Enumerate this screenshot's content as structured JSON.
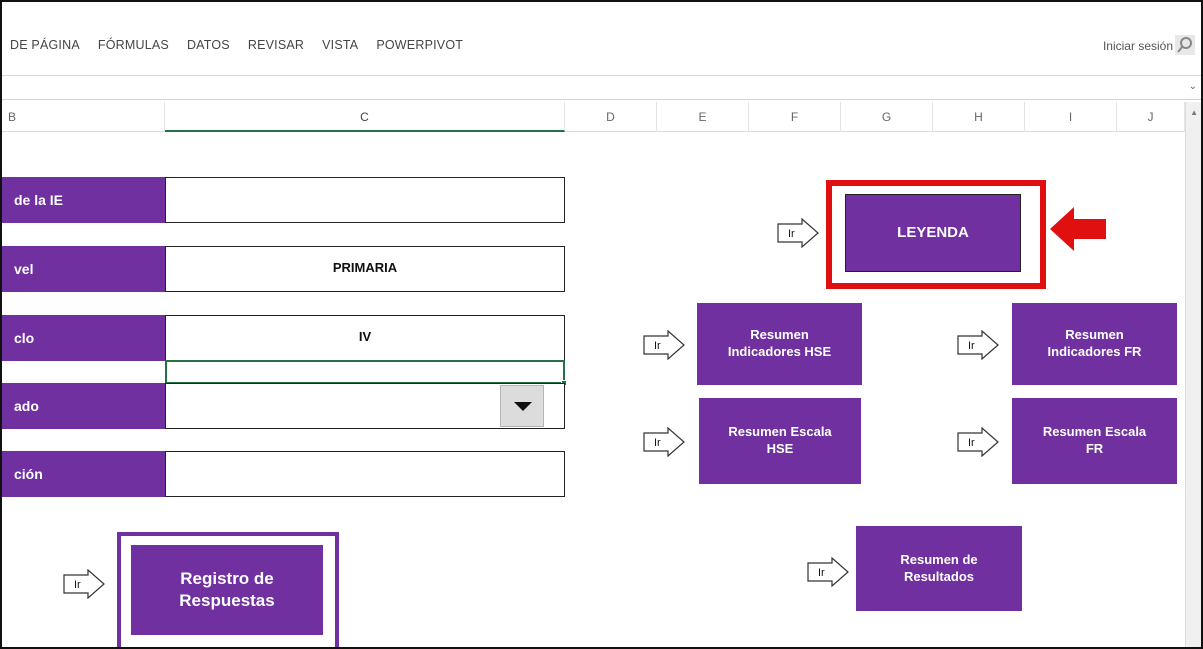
{
  "ribbon": {
    "tabs": [
      "DE PÁGINA",
      "FÓRMULAS",
      "DATOS",
      "REVISAR",
      "VISTA",
      "POWERPIVOT"
    ],
    "signin": "Iniciar sesión",
    "search_icon": "search-icon"
  },
  "columns": [
    "B",
    "C",
    "D",
    "E",
    "F",
    "G",
    "H",
    "I",
    "J"
  ],
  "form": {
    "labels": [
      "de la IE",
      "vel",
      "clo",
      "ado",
      "ción"
    ],
    "values": [
      "",
      "PRIMARIA",
      "IV",
      "",
      ""
    ]
  },
  "buttons": {
    "leyenda": "LEYENDA",
    "resumen_indicadores_hse": "Resumen\nIndicadores HSE",
    "resumen_indicadores_fr": "Resumen\nIndicadores FR",
    "resumen_escala_hse": "Resumen Escala\nHSE",
    "resumen_escala_fr": "Resumen Escala\nFR",
    "resumen_resultados": "Resumen de\nResultados",
    "registro_respuestas": "Registro de\nRespuestas"
  },
  "go_label": "Ir",
  "colors": {
    "purple": "#7030a0",
    "highlight_red": "#e01010",
    "excel_green": "#217346"
  }
}
